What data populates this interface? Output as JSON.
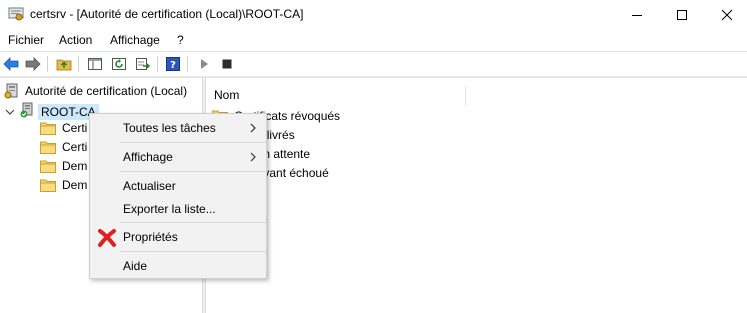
{
  "window": {
    "app_icon": "certsrv-app-icon",
    "title": "certsrv - [Autorité de certification (Local)\\ROOT-CA]"
  },
  "menubar": {
    "items": [
      "Fichier",
      "Action",
      "Affichage",
      "?"
    ]
  },
  "toolbar": {
    "icons": [
      "back-arrow-icon",
      "forward-arrow-icon",
      "up-folder-icon",
      "show-hide-tree-icon",
      "refresh-icon",
      "export-list-icon",
      "help-icon",
      "start-service-icon",
      "stop-service-icon"
    ]
  },
  "tree": {
    "root_label": "Autorité de certification (Local)",
    "ca_label": "ROOT-CA",
    "children": [
      "Certi",
      "Certi",
      "Dem",
      "Dem"
    ]
  },
  "list": {
    "column_header": "Nom",
    "rows": [
      "Certificats révoqués",
      "ats délivrés",
      "des en attente",
      "des ayant échoué"
    ]
  },
  "context_menu": {
    "items": [
      {
        "label": "Toutes les tâches",
        "submenu": true
      },
      {
        "label": "Affichage",
        "submenu": true
      },
      {
        "label": "Actualiser",
        "submenu": false
      },
      {
        "label": "Exporter la liste...",
        "submenu": false
      },
      {
        "label": "Propriétés",
        "submenu": false
      },
      {
        "label": "Aide",
        "submenu": false
      }
    ]
  },
  "colors": {
    "selection": "#cce8ff",
    "folder": "#f5c542",
    "annotation_x": "#e02020"
  }
}
